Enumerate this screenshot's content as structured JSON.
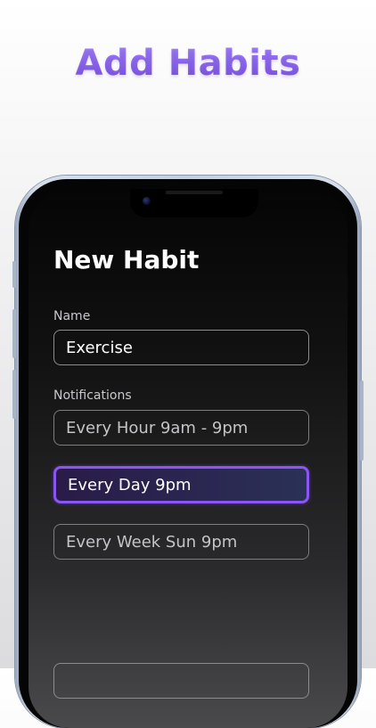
{
  "banner": {
    "headline": "Add Habits"
  },
  "screen": {
    "title": "New Habit",
    "name_label": "Name",
    "name_value": "Exercise",
    "notifications_label": "Notifications",
    "options": [
      {
        "label": "Every Hour 9am - 9pm",
        "selected": false
      },
      {
        "label": "Every Day 9pm",
        "selected": true
      },
      {
        "label": "Every Week Sun 9pm",
        "selected": false
      }
    ]
  },
  "colors": {
    "accent": "#8a55f2",
    "headline": "#8a63f0",
    "screen_bg": "#111111",
    "frame": "#c5cedd"
  }
}
